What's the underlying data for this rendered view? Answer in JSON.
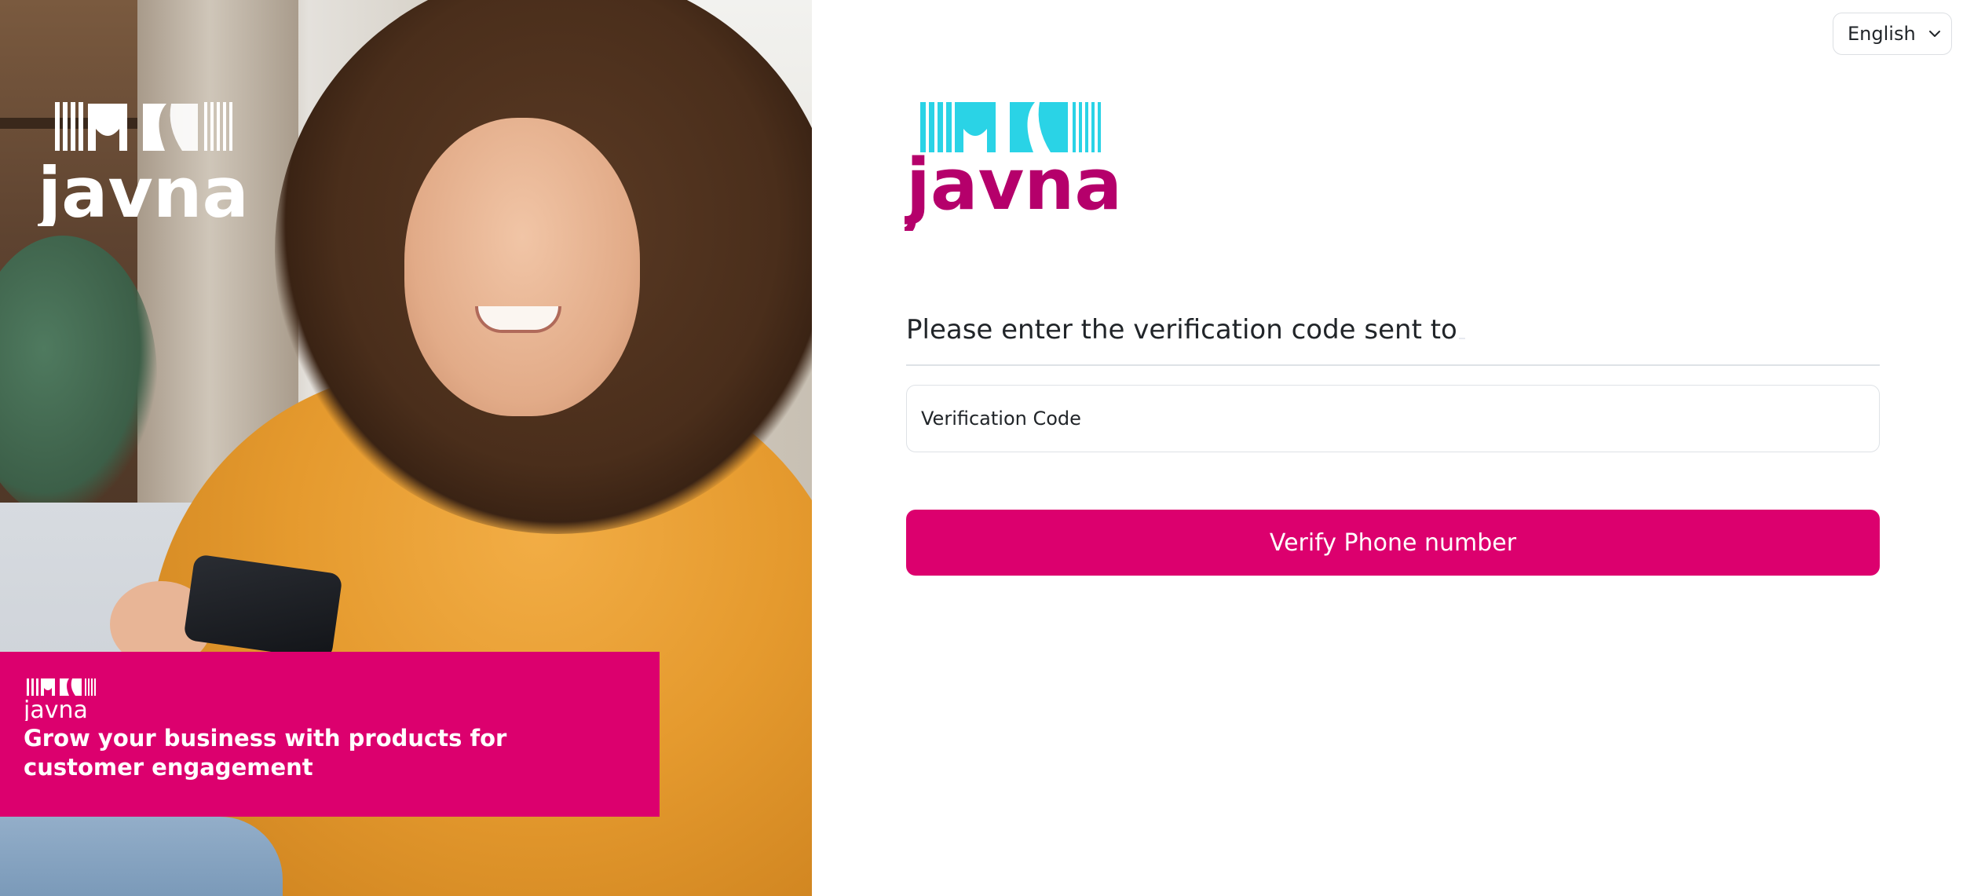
{
  "brand": {
    "logo_text": "javna",
    "accent_color": "#dc006e",
    "logo_cyan": "#2ad3e6",
    "logo_magenta": "#b5006b"
  },
  "hero": {
    "image": "woman-smiling-with-phone-photo",
    "tagline": "Grow your business with products for customer engagement"
  },
  "header": {
    "language": "English",
    "language_icon": "chevron-down-icon"
  },
  "form": {
    "prompt": "Please enter the verification code sent to",
    "code_placeholder": "Verification Code",
    "code_value": "",
    "submit_label": "Verify Phone number"
  }
}
